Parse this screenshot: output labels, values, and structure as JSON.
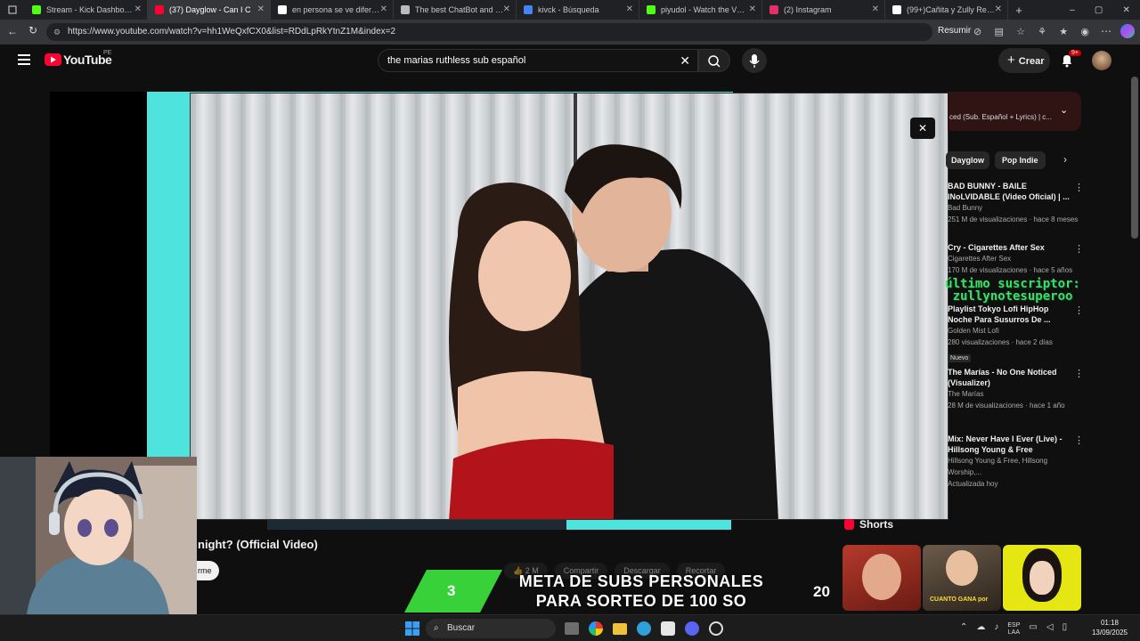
{
  "tabs": [
    {
      "title": "Stream - Kick Dashboard",
      "color": "#53fc18"
    },
    {
      "title": "(37) Dayglow - Can I C",
      "color": "#ff0033"
    },
    {
      "title": "en persona se ve diferente",
      "color": "#ffffff"
    },
    {
      "title": "The best ChatBot and Widg",
      "color": "#bbbbbb"
    },
    {
      "title": "kivck - Búsqueda",
      "color": "#4285f4"
    },
    {
      "title": "piyudol - Watch the VOD o",
      "color": "#53fc18"
    },
    {
      "title": "(2) Instagram",
      "color": "#e1306c"
    },
    {
      "title": "(99+)Cañita y Zully Reencu",
      "color": "#ffffff"
    }
  ],
  "browser": {
    "url": "https://www.youtube.com/watch?v=hh1WeQxfCX0&list=RDdLpRkYtnZ1M&index=2",
    "resume_label": "Resumir"
  },
  "youtube": {
    "logo_text": "YouTube",
    "region": "PE",
    "search_value": "the marias ruthless sub español",
    "create_label": "Crear",
    "notif_badge": "9+"
  },
  "playlist": {
    "subtitle": "ced (Sub. Español + Lyrics) | c..."
  },
  "chips": [
    "Dayglow",
    "Pop Indie"
  ],
  "videos": [
    {
      "title": "BAD BUNNY - BAILE\nINoLVIDABLE (Video Oficial) | ...",
      "channel": "Bad Bunny",
      "meta": "251 M de visualizaciones · hace 8 meses",
      "badge": ""
    },
    {
      "title": "Cry - Cigarettes After Sex",
      "channel": "Cigarettes After Sex",
      "meta": "170 M de visualizaciones · hace 5 años",
      "badge": ""
    },
    {
      "title": "Playlist Tokyo Lofi HipHop\nNoche Para Susurros De ...",
      "channel": "Golden Mist Lofi",
      "meta": "280 visualizaciones · hace 2 días",
      "badge": "Nuevo"
    },
    {
      "title": "The Marías - No One Noticed\n(Visualizer)",
      "channel": "The Marías",
      "meta": "28 M de visualizaciones · hace 1 año",
      "badge": ""
    },
    {
      "title": "Mix: Never Have I Ever (Live) -\nHillsong Young & Free",
      "channel": "Hillsong Young & Free, Hillsong Worship,...",
      "meta": "Actualizada hoy",
      "badge": ""
    }
  ],
  "overlay_subscriber": {
    "line1": "último suscriptor:",
    "line2": "zullynotesuperoo"
  },
  "shorts_label": "Shorts",
  "shorts_captions": [
    "",
    "CUANTO GANA por",
    ""
  ],
  "main_video": {
    "title_fragment": "night? (Official Video)",
    "left_button": "rme",
    "views": "2 M",
    "actions": [
      "Compartir",
      "Descargar",
      "Recortar"
    ]
  },
  "sub_goal": {
    "current": "3",
    "goal": "20",
    "line1": "META DE SUBS PERSONALES",
    "line2": "PARA SORTEO DE 100 SO"
  },
  "taskbar": {
    "search_label": "Buscar",
    "lang1": "ESP",
    "lang2": "LAA",
    "time": "01:18",
    "date": "13/09/2025"
  },
  "colors": {
    "cyan": "#4ee3dc",
    "yt_red": "#ff0033",
    "green_goal": "#39d13a",
    "sub_text": "#38e06a"
  }
}
